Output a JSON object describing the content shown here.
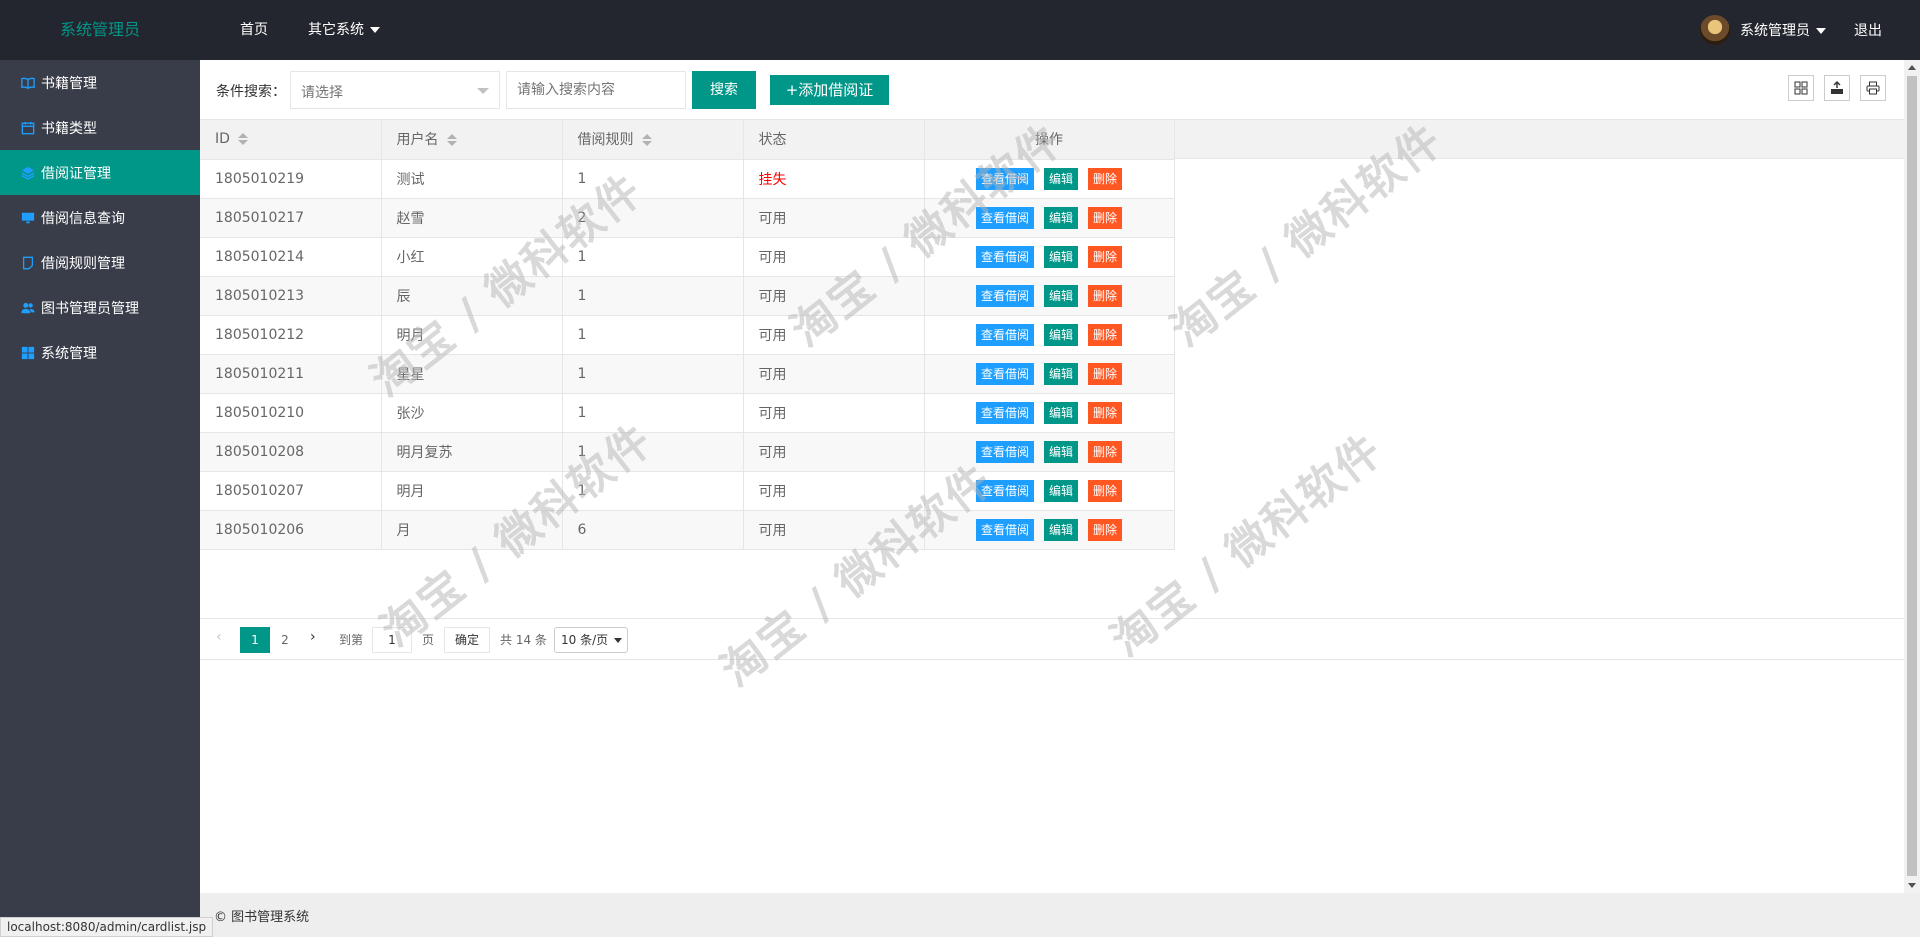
{
  "header": {
    "logo": "系统管理员",
    "nav": [
      {
        "label": "首页",
        "dropdown": false
      },
      {
        "label": "其它系统",
        "dropdown": true
      }
    ],
    "user_name": "系统管理员",
    "logout": "退出"
  },
  "sidebar": {
    "items": [
      {
        "label": "书籍管理",
        "icon": "book-open-icon",
        "active": false
      },
      {
        "label": "书籍类型",
        "icon": "calendar-icon",
        "active": false
      },
      {
        "label": "借阅证管理",
        "icon": "layers-icon",
        "active": true
      },
      {
        "label": "借阅信息查询",
        "icon": "monitor-icon",
        "active": false
      },
      {
        "label": "借阅规则管理",
        "icon": "note-icon",
        "active": false
      },
      {
        "label": "图书管理员管理",
        "icon": "users-icon",
        "active": false
      },
      {
        "label": "系统管理",
        "icon": "windows-icon",
        "active": false
      }
    ]
  },
  "toolbar": {
    "label": "条件搜索：",
    "select_placeholder": "请选择",
    "search_placeholder": "请输入搜索内容",
    "search_button": "搜索",
    "add_button": "+添加借阅证",
    "tool_icons": [
      "columns-icon",
      "export-icon",
      "print-icon"
    ]
  },
  "table": {
    "columns": [
      "ID",
      "用户名",
      "借阅规则",
      "状态",
      "操作"
    ],
    "rows": [
      {
        "id": "1805010219",
        "username": "测试",
        "rule": "1",
        "status": "挂失",
        "status_color": "#ff0000"
      },
      {
        "id": "1805010217",
        "username": "赵雪",
        "rule": "2",
        "status": "可用",
        "status_color": "#666666"
      },
      {
        "id": "1805010214",
        "username": "小红",
        "rule": "1",
        "status": "可用",
        "status_color": "#666666"
      },
      {
        "id": "1805010213",
        "username": "辰",
        "rule": "1",
        "status": "可用",
        "status_color": "#666666"
      },
      {
        "id": "1805010212",
        "username": "明月",
        "rule": "1",
        "status": "可用",
        "status_color": "#666666"
      },
      {
        "id": "1805010211",
        "username": "星星",
        "rule": "1",
        "status": "可用",
        "status_color": "#666666"
      },
      {
        "id": "1805010210",
        "username": "张沙",
        "rule": "1",
        "status": "可用",
        "status_color": "#666666"
      },
      {
        "id": "1805010208",
        "username": "明月复苏",
        "rule": "1",
        "status": "可用",
        "status_color": "#666666"
      },
      {
        "id": "1805010207",
        "username": "明月",
        "rule": "1",
        "status": "可用",
        "status_color": "#666666"
      },
      {
        "id": "1805010206",
        "username": "月",
        "rule": "6",
        "status": "可用",
        "status_color": "#666666"
      }
    ],
    "actions": {
      "view": "查看借阅",
      "edit": "编辑",
      "delete": "删除"
    }
  },
  "pager": {
    "current_page": "1",
    "other_page": "2",
    "goto_label": "到第",
    "goto_value": "1",
    "page_label": "页",
    "confirm": "确定",
    "total": "共 14 条",
    "page_size": "10 条/页"
  },
  "footer": {
    "text": "© 图书管理系统"
  },
  "statusbar": {
    "url": "localhost:8080/admin/cardlist.jsp"
  },
  "watermark": "淘宝 / 微科软件",
  "colors": {
    "accent": "#009688",
    "header": "#23262e",
    "sidebar": "#393d49",
    "view": "#1e9fff",
    "delete": "#ff5722",
    "lost": "#ff0000"
  }
}
